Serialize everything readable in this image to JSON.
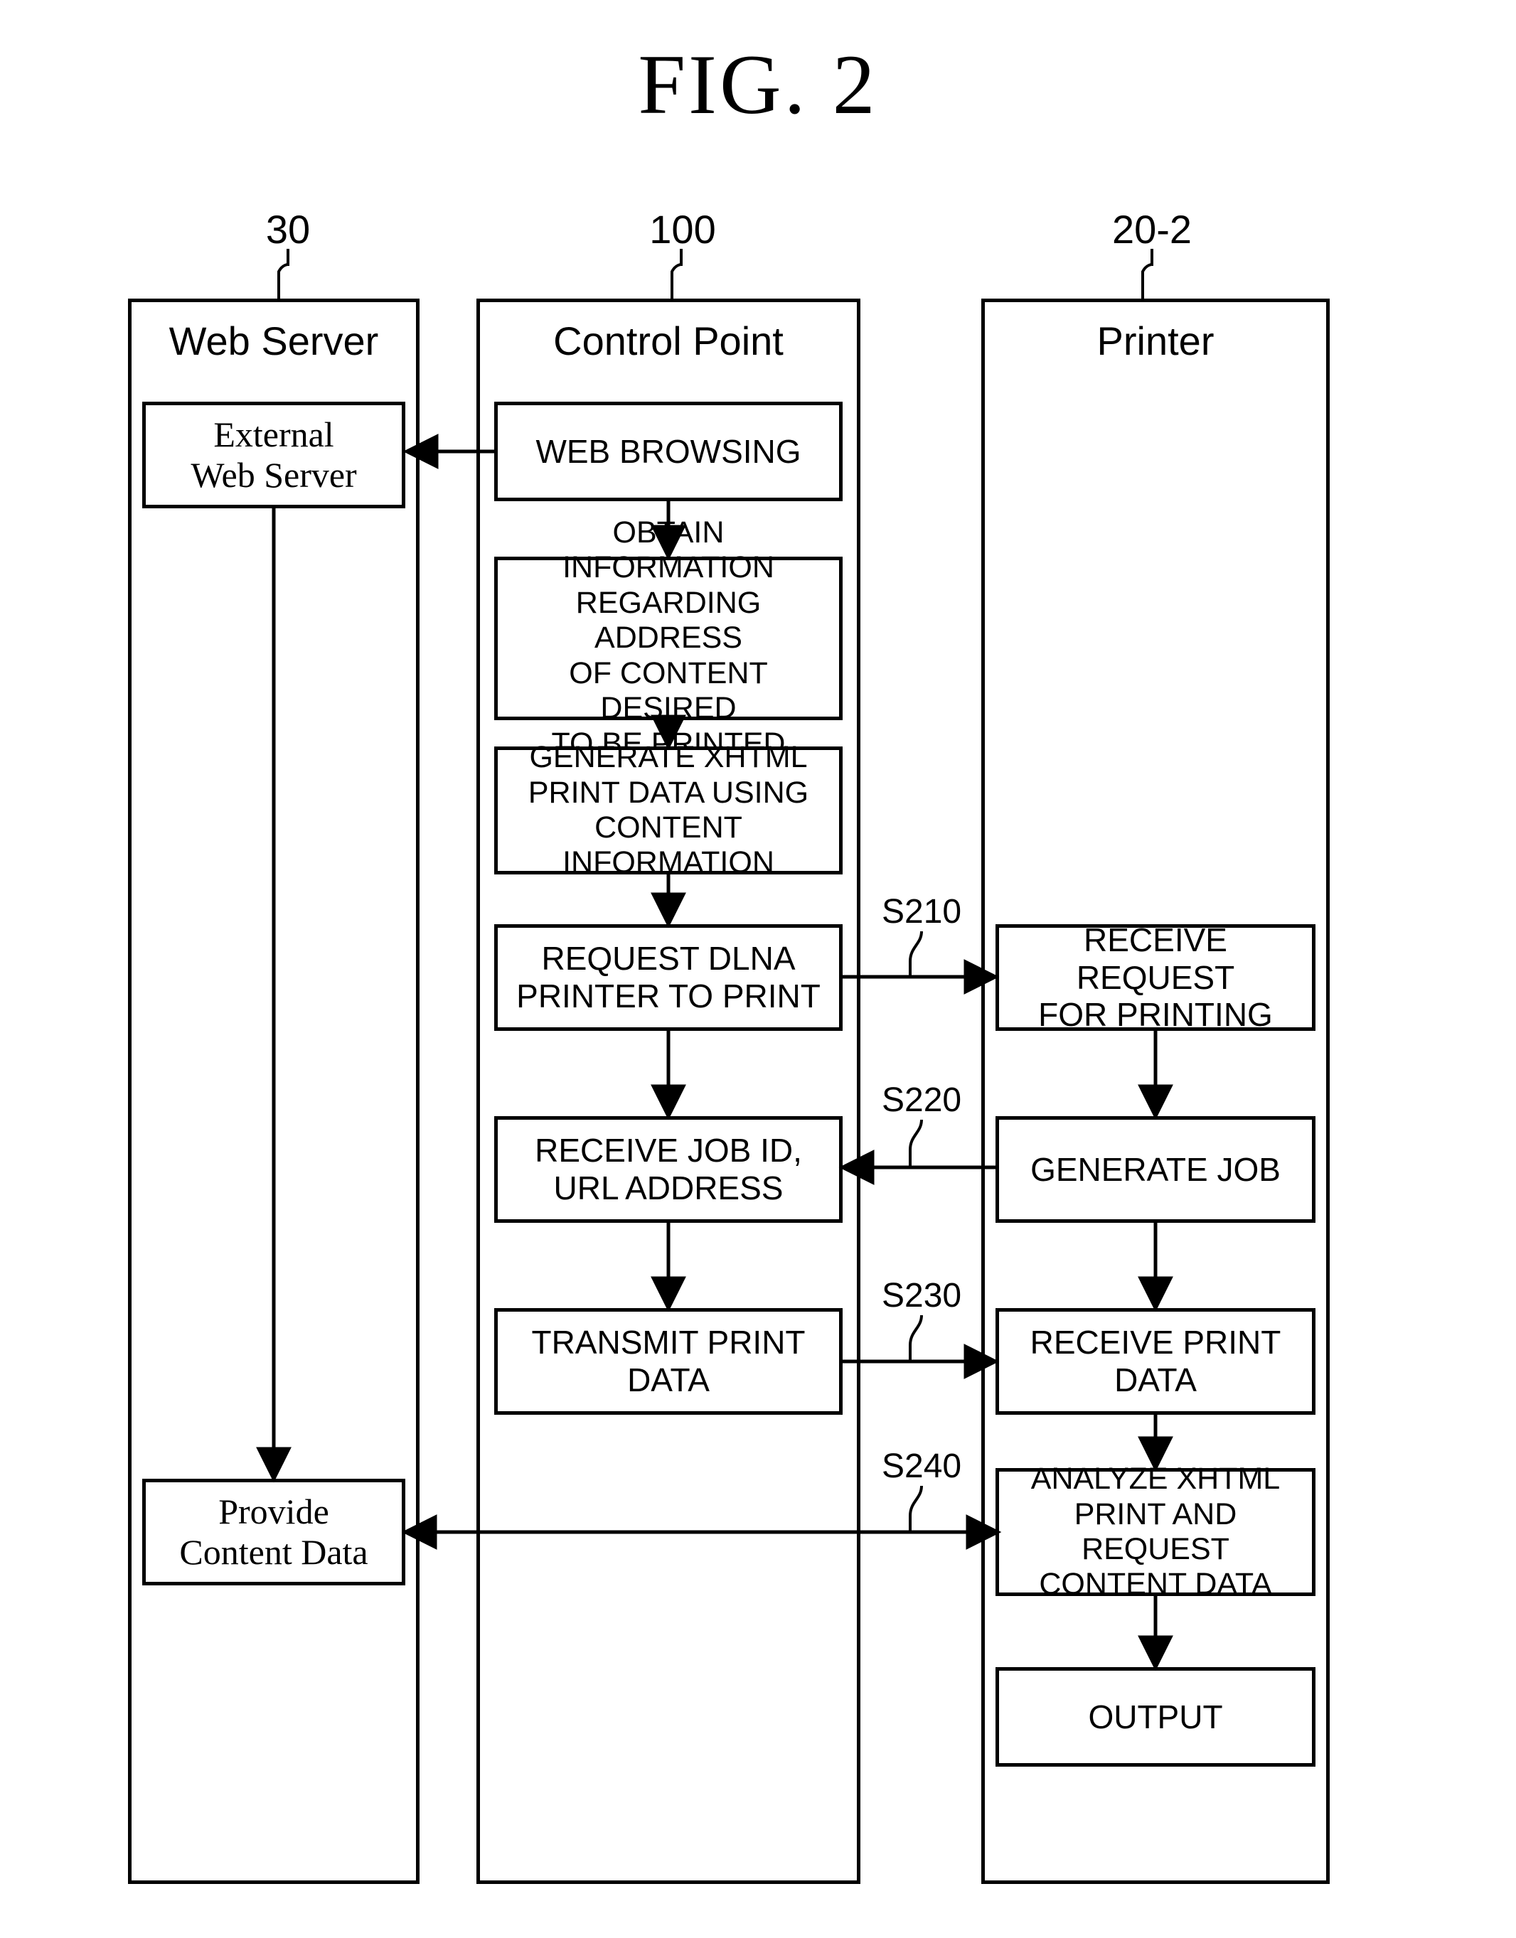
{
  "figure_title": "FIG. 2",
  "lanes": {
    "web_server": {
      "ref": "30",
      "title": "Web Server"
    },
    "control_point": {
      "ref": "100",
      "title": "Control Point"
    },
    "printer": {
      "ref": "20-2",
      "title": "Printer"
    }
  },
  "boxes": {
    "external_ws": "External\nWeb Server",
    "provide_content": "Provide\nContent Data",
    "web_browsing": "WEB BROWSING",
    "obtain_info": "OBTAIN INFORMATION\nREGARDING ADDRESS\nOF CONTENT DESIRED\nTO BE PRINTED",
    "gen_xhtml": "GENERATE XHTML\nPRINT DATA USING\nCONTENT INFORMATION",
    "request_dlna": "REQUEST DLNA\nPRINTER TO PRINT",
    "recv_jobid": "RECEIVE JOB ID,\nURL ADDRESS",
    "xmit_print": "TRANSMIT PRINT\nDATA",
    "recv_req": "RECEIVE REQUEST\nFOR PRINTING",
    "gen_job": "GENERATE JOB",
    "recv_print": "RECEIVE PRINT DATA",
    "analyze": "ANALYZE XHTML\nPRINT AND REQUEST\nCONTENT DATA",
    "output": "OUTPUT"
  },
  "steps": {
    "s210": "S210",
    "s220": "S220",
    "s230": "S230",
    "s240": "S240"
  }
}
